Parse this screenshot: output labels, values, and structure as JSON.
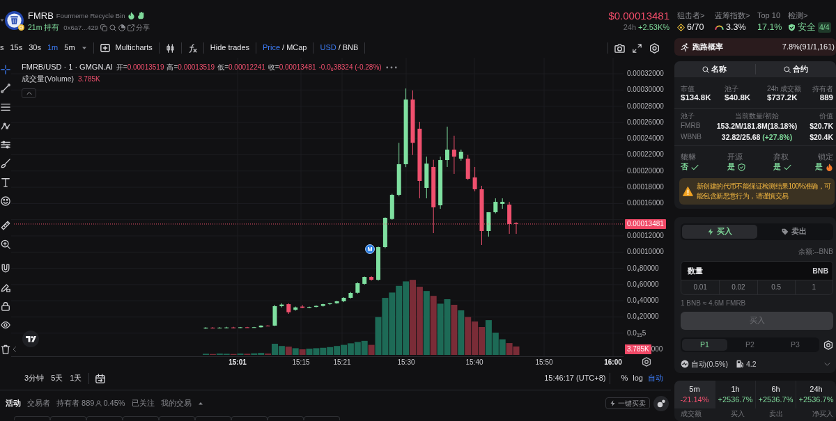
{
  "token": {
    "symbol": "FMRB",
    "name": "Fourmeme Recycle Bin",
    "age": "21m 持有",
    "address": "0x6a7...429",
    "share": "分享"
  },
  "price": {
    "value": "$0.00013481",
    "period": "24h",
    "change": "+2.53K%"
  },
  "stats": [
    {
      "kind": "snipers",
      "label": "狙击者>",
      "value": "6/70"
    },
    {
      "kind": "bluechip",
      "label": "蓝筹指数>",
      "value": "3.3%"
    },
    {
      "kind": "top10",
      "label": "Top 10",
      "value": "17.1%"
    },
    {
      "kind": "audit",
      "label": "检测>",
      "value": "安全",
      "badge": "4/4"
    }
  ],
  "toolbar": {
    "intervals": [
      {
        "label": "s",
        "selected": false
      },
      {
        "label": "15s",
        "selected": false
      },
      {
        "label": "30s",
        "selected": false
      },
      {
        "label": "1m",
        "selected": true
      },
      {
        "label": "5m",
        "selected": false
      }
    ],
    "multicharts": "Multicharts",
    "hide_trades": "Hide trades",
    "toggles": [
      {
        "separator": "/",
        "options": [
          {
            "label": "Price",
            "selected": true
          },
          {
            "label": "MCap",
            "selected": false
          }
        ]
      },
      {
        "separator": "/",
        "options": [
          {
            "label": "USD",
            "selected": true
          },
          {
            "label": "BNB",
            "selected": false
          }
        ]
      }
    ]
  },
  "drawing_tools": [
    [
      {
        "kind": "crosshair",
        "selected": true
      },
      {
        "kind": "trend_line",
        "selected": false
      },
      {
        "kind": "horizontal_lines",
        "selected": false
      },
      {
        "kind": "path",
        "selected": false
      },
      {
        "kind": "sliders",
        "selected": false
      },
      {
        "kind": "brush",
        "selected": false
      },
      {
        "kind": "text",
        "selected": false
      },
      {
        "kind": "emoji",
        "selected": false
      }
    ],
    [
      {
        "kind": "ruler",
        "selected": false
      },
      {
        "kind": "zoom",
        "selected": false
      }
    ],
    [
      {
        "kind": "magnet",
        "selected": false
      },
      {
        "kind": "pencil_lock",
        "selected": false
      },
      {
        "kind": "lock",
        "selected": false
      },
      {
        "kind": "eye",
        "selected": false
      }
    ],
    [
      {
        "kind": "trash",
        "selected": false
      }
    ]
  ],
  "chart": {
    "legend": {
      "title": "FMRB/USD · 1 · GMGN.AI",
      "ohlc": [
        {
          "label": "开=",
          "value": "0.00013519"
        },
        {
          "label": "高=",
          "value": "0.00013519"
        },
        {
          "label": "低=",
          "value": "0.00012241"
        },
        {
          "label": "收=",
          "value": "0.00013481"
        }
      ],
      "change": "-0.0$_{6}$38324 (-0.28%)",
      "volume_label": "成交量(Volume)",
      "volume_value": "3.785K"
    },
    "marker": "M",
    "price_axis": [
      {
        "kind": "tick",
        "label": "0.00032000"
      },
      {
        "kind": "tick",
        "label": "0.00030000"
      },
      {
        "kind": "tick",
        "label": "0.00028000"
      },
      {
        "kind": "tick",
        "label": "0.00026000"
      },
      {
        "kind": "tick",
        "label": "0.00024000"
      },
      {
        "kind": "tick",
        "label": "0.00022000"
      },
      {
        "kind": "tick",
        "label": "0.00020000"
      },
      {
        "kind": "tick",
        "label": "0.00018000"
      },
      {
        "kind": "tick",
        "label": "0.00016000"
      },
      {
        "kind": "current",
        "label": "0.00013481"
      },
      {
        "kind": "tick",
        "label": "0.00012000"
      },
      {
        "kind": "tick",
        "label": "0.00010000"
      },
      {
        "kind": "tick",
        "label": "0.0$_{4}$80000"
      },
      {
        "kind": "tick",
        "label": "0.0$_{4}$60000"
      },
      {
        "kind": "tick",
        "label": "0.0$_{4}$40000"
      },
      {
        "kind": "tick",
        "label": "0.0$_{4}$20000"
      },
      {
        "kind": "tick",
        "label": "0.0$_{15}$5"
      },
      {
        "kind": "volume",
        "label": "3.785K",
        "tail": "000"
      }
    ],
    "time_ticks": [
      {
        "label": "15:01",
        "major": true
      },
      {
        "label": "15:15",
        "major": false
      },
      {
        "label": "15:21",
        "major": false
      },
      {
        "label": "15:30",
        "major": false
      },
      {
        "label": "15:40",
        "major": false
      },
      {
        "label": "15:50",
        "major": false
      },
      {
        "label": "16:00",
        "major": true
      }
    ]
  },
  "bottom_bar": {
    "ranges": [
      "3分钟",
      "5天",
      "1天"
    ],
    "clock": "15:46:17 (UTC+8)",
    "scales": [
      {
        "label": "%",
        "selected": false
      },
      {
        "label": "log",
        "selected": false
      },
      {
        "label": "自动",
        "selected": true
      }
    ]
  },
  "activity": {
    "tabs": [
      {
        "label": "活动",
        "selected": true
      },
      {
        "label": "交易者",
        "selected": false
      },
      {
        "label": "持有者 889",
        "selected": false,
        "note": "0.45%"
      },
      {
        "label": "已关注",
        "selected": false
      },
      {
        "label": "我的交易",
        "selected": false
      }
    ],
    "quick_trade": "一键买卖"
  },
  "risk": {
    "label": "跑路概率",
    "value": "7.8%(91/1,161)"
  },
  "info": {
    "search_tabs": [
      "名称",
      "合约"
    ],
    "metrics": [
      {
        "label": "市值",
        "value": "$134.8K"
      },
      {
        "label": "池子",
        "value": "$40.8K"
      },
      {
        "label": "24h 成交额",
        "value": "$737.2K"
      },
      {
        "label": "持有者",
        "value": "889"
      }
    ],
    "pool": {
      "columns": [
        "池子",
        "当前数量/初始",
        "价值"
      ],
      "rows": [
        {
          "token": "FMRB",
          "amount": "153.2M/181.8M(18.18%)",
          "value": "$20.7K"
        },
        {
          "token": "WBNB",
          "amount": "32.82/25.68",
          "change": "(+27.8%)",
          "value": "$20.4K"
        }
      ]
    },
    "checks": [
      {
        "kind": "check",
        "label": "貔貅",
        "value": "否"
      },
      {
        "kind": "shield",
        "label": "开源",
        "value": "是"
      },
      {
        "kind": "check",
        "label": "弃权",
        "value": "是"
      },
      {
        "kind": "fire",
        "label": "锁定",
        "value": "是"
      }
    ],
    "warning": "新创建的代币不能保证检测结果100%准确，可能包含新恶意行为，请谨慎交易"
  },
  "trade": {
    "tabs": [
      {
        "kind": "buy",
        "label": "买入",
        "selected": true
      },
      {
        "kind": "sell",
        "label": "卖出",
        "selected": false
      }
    ],
    "balance": "余额:--BNB",
    "amount": {
      "label": "数量",
      "unit": "BNB"
    },
    "presets": [
      "0.01",
      "0.02",
      "0.5",
      "1"
    ],
    "rate": "1 BNB ≈ 4.6M FMRB",
    "submit": {
      "label": "买入",
      "disabled": true
    },
    "profiles": [
      {
        "label": "P1",
        "selected": true
      },
      {
        "label": "P2",
        "selected": false
      },
      {
        "label": "P3",
        "selected": false
      }
    ],
    "slippage": "自动(0.5%)",
    "gas": "4.2"
  },
  "periods": [
    {
      "label": "5m",
      "change": "-21.14%",
      "falling": true,
      "selected": true
    },
    {
      "label": "1h",
      "change": "+2536.7%",
      "falling": false,
      "selected": false
    },
    {
      "label": "6h",
      "change": "+2536.7%",
      "falling": false,
      "selected": false
    },
    {
      "label": "24h",
      "change": "+2536.7%",
      "falling": false,
      "selected": false
    }
  ],
  "period_columns": [
    "成交额",
    "买入",
    "卖出",
    "净买入"
  ]
}
